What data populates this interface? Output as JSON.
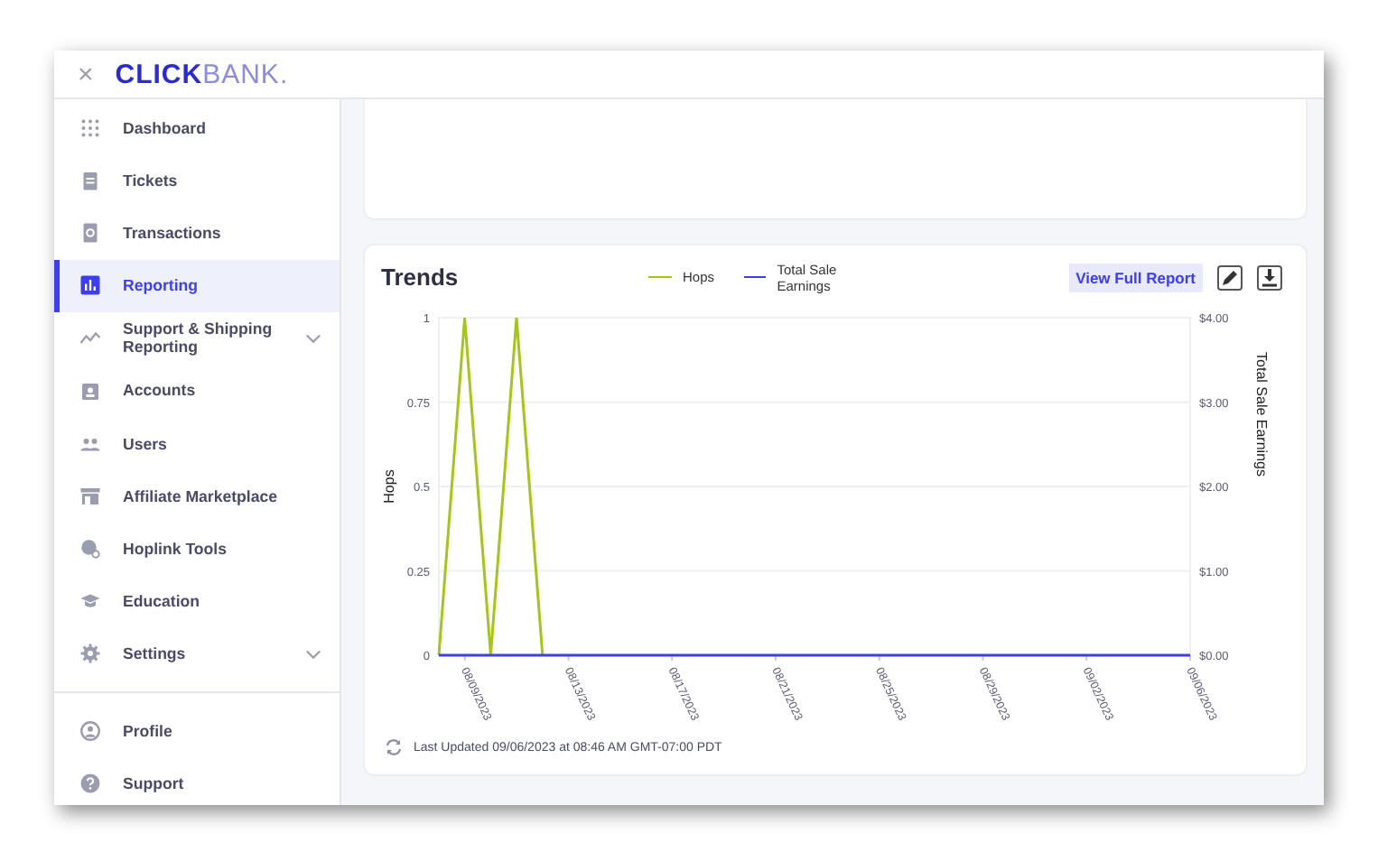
{
  "header": {
    "close": "×",
    "logo_bold": "CLICK",
    "logo_light": "BANK."
  },
  "sidebar": {
    "items": [
      {
        "label": "Dashboard",
        "selected": false
      },
      {
        "label": "Tickets",
        "selected": false
      },
      {
        "label": "Transactions",
        "selected": false
      },
      {
        "label": "Reporting",
        "selected": true
      },
      {
        "label": "Support & Shipping Reporting",
        "selected": false,
        "kind": "group",
        "expanded": false
      },
      {
        "label": "Accounts",
        "selected": false
      },
      {
        "label": "Users",
        "selected": false
      },
      {
        "label": "Affiliate Marketplace",
        "selected": false
      },
      {
        "label": "Hoplink Tools",
        "selected": false
      },
      {
        "label": "Education",
        "selected": false
      },
      {
        "label": "Settings",
        "selected": false,
        "kind": "group",
        "expanded": false
      }
    ],
    "bottom_items": [
      {
        "label": "Profile",
        "selected": false
      },
      {
        "label": "Support",
        "selected": false
      }
    ]
  },
  "trends": {
    "title": "Trends",
    "view_full_report": "View Full Report",
    "last_updated": "Last Updated 09/06/2023 at 08:46 AM GMT-07:00 PDT",
    "chart_data": {
      "type": "line",
      "ylabel": "Hops",
      "y2label": "Total Sale Earnings",
      "categories": [
        null,
        "08/09/2023",
        null,
        null,
        null,
        "08/13/2023",
        null,
        null,
        null,
        "08/17/2023",
        null,
        null,
        null,
        "08/21/2023",
        null,
        null,
        null,
        "08/25/2023",
        null,
        null,
        null,
        "08/29/2023",
        null,
        null,
        null,
        "09/02/2023",
        null,
        null,
        null,
        "09/06/2023"
      ],
      "grid": true,
      "legend": "top",
      "ylim": [
        0,
        1
      ],
      "yticks": [
        0,
        {
          "value": 0.25,
          "label": "0.25"
        },
        {
          "value": 0.5,
          "label": "0.5"
        },
        {
          "value": 0.75,
          "label": "0.75"
        },
        1
      ],
      "y2lim": [
        0,
        4
      ],
      "y2ticks": [
        {
          "value": 0,
          "label": "$0.00"
        },
        {
          "value": 1,
          "label": "$1.00"
        },
        {
          "value": 2,
          "label": "$2.00"
        },
        {
          "value": 3,
          "label": "$3.00"
        },
        {
          "value": 4,
          "label": "$4.00"
        }
      ],
      "series": [
        {
          "name": "Hops",
          "color": "#a4c614",
          "values": [
            0,
            1,
            0,
            1,
            0,
            null,
            null,
            null,
            null,
            null,
            null,
            null,
            null,
            null,
            null,
            null,
            null,
            null,
            null,
            null,
            null,
            null,
            null,
            null,
            null,
            null,
            null,
            null,
            null,
            null
          ]
        },
        {
          "name": "Total Sale Earnings",
          "color": "#3d3df5",
          "values": [
            0,
            0,
            0,
            0,
            0,
            0,
            0,
            0,
            0,
            0,
            0,
            0,
            0,
            0,
            0,
            0,
            0,
            0,
            0,
            0,
            0,
            0,
            0,
            0,
            0,
            0,
            0,
            0,
            0,
            0
          ]
        }
      ]
    }
  }
}
